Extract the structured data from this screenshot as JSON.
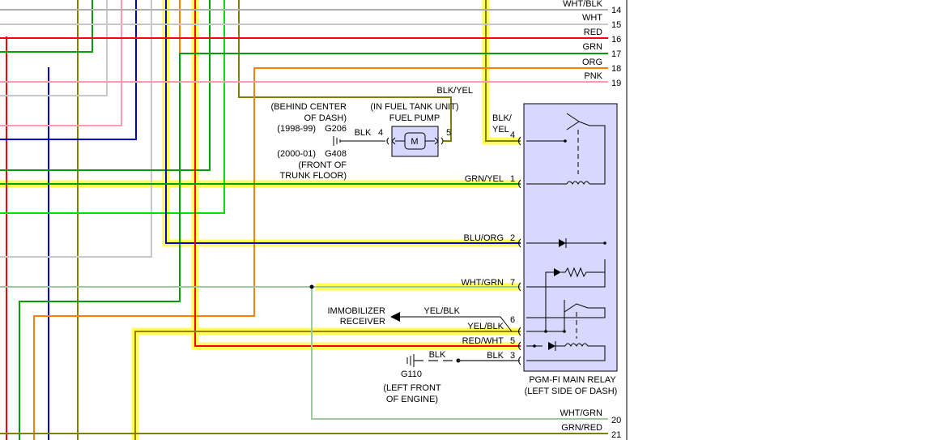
{
  "right_wires": [
    {
      "color_label": "WHT/BLK",
      "pin": "14",
      "color": "#b0b0b0"
    },
    {
      "color_label": "WHT",
      "pin": "15",
      "color": "#c8c8c8"
    },
    {
      "color_label": "RED",
      "pin": "16",
      "color": "#ff0000"
    },
    {
      "color_label": "GRN",
      "pin": "17",
      "color": "#00a000"
    },
    {
      "color_label": "ORG",
      "pin": "18",
      "color": "#ff8000"
    },
    {
      "color_label": "PNK",
      "pin": "19",
      "color": "#ff9ab0"
    },
    {
      "color_label": "WHT/GRN",
      "pin": "20",
      "color": "#a0c8a0"
    },
    {
      "color_label": "GRN/RED",
      "pin": "21",
      "color": "#808000"
    }
  ],
  "fuel_pump": {
    "location": "(IN FUEL TANK UNIT)",
    "name": "FUEL PUMP",
    "motor": "M",
    "pin_left": "4",
    "pin_right": "5",
    "wire_left": "BLK",
    "wire_top": "BLK/YEL"
  },
  "ground_g206": {
    "loc_line1": "(BEHIND CENTER",
    "loc_line2": "OF DASH)",
    "years": "(1998-99)",
    "id": "G206"
  },
  "ground_g408": {
    "years": "(2000-01)",
    "id": "G408",
    "loc_line1": "(FRONT OF",
    "loc_line2": "TRUNK FLOOR)"
  },
  "relay": {
    "name_line1": "PGM-FI MAIN RELAY",
    "name_line2": "(LEFT SIDE OF DASH)",
    "pins": [
      {
        "wire": "BLK/",
        "wire2": "YEL",
        "pin": "4"
      },
      {
        "wire": "GRN/YEL",
        "pin": "1"
      },
      {
        "wire": "BLU/ORG",
        "pin": "2"
      },
      {
        "wire": "WHT/GRN",
        "pin": "7"
      },
      {
        "wire": "YEL/BLK",
        "pin": "6"
      },
      {
        "wire": "RED/WHT",
        "pin": "5"
      },
      {
        "wire": "BLK",
        "pin": "3"
      }
    ]
  },
  "immobilizer": {
    "line1": "IMMOBILIZER",
    "line2": "RECEIVER",
    "wire": "YEL/BLK"
  },
  "ground_g110": {
    "wire": "BLK",
    "id": "G110",
    "loc_line1": "(LEFT FRONT",
    "loc_line2": "OF ENGINE)"
  },
  "colors": {
    "highlight": "#ffff55",
    "relay_fill": "#d8d8ff",
    "pump_fill": "#d8d8ff",
    "blk_yel_wire": "#808000",
    "grn_yel_wire": "#00a000",
    "blu_org_wire": "#0000d0",
    "wht_grn_wire": "#a0c8a0",
    "yel_blk_wire": "#a08000",
    "red_wht_wire": "#ff0000",
    "blk_wire": "#404040"
  }
}
